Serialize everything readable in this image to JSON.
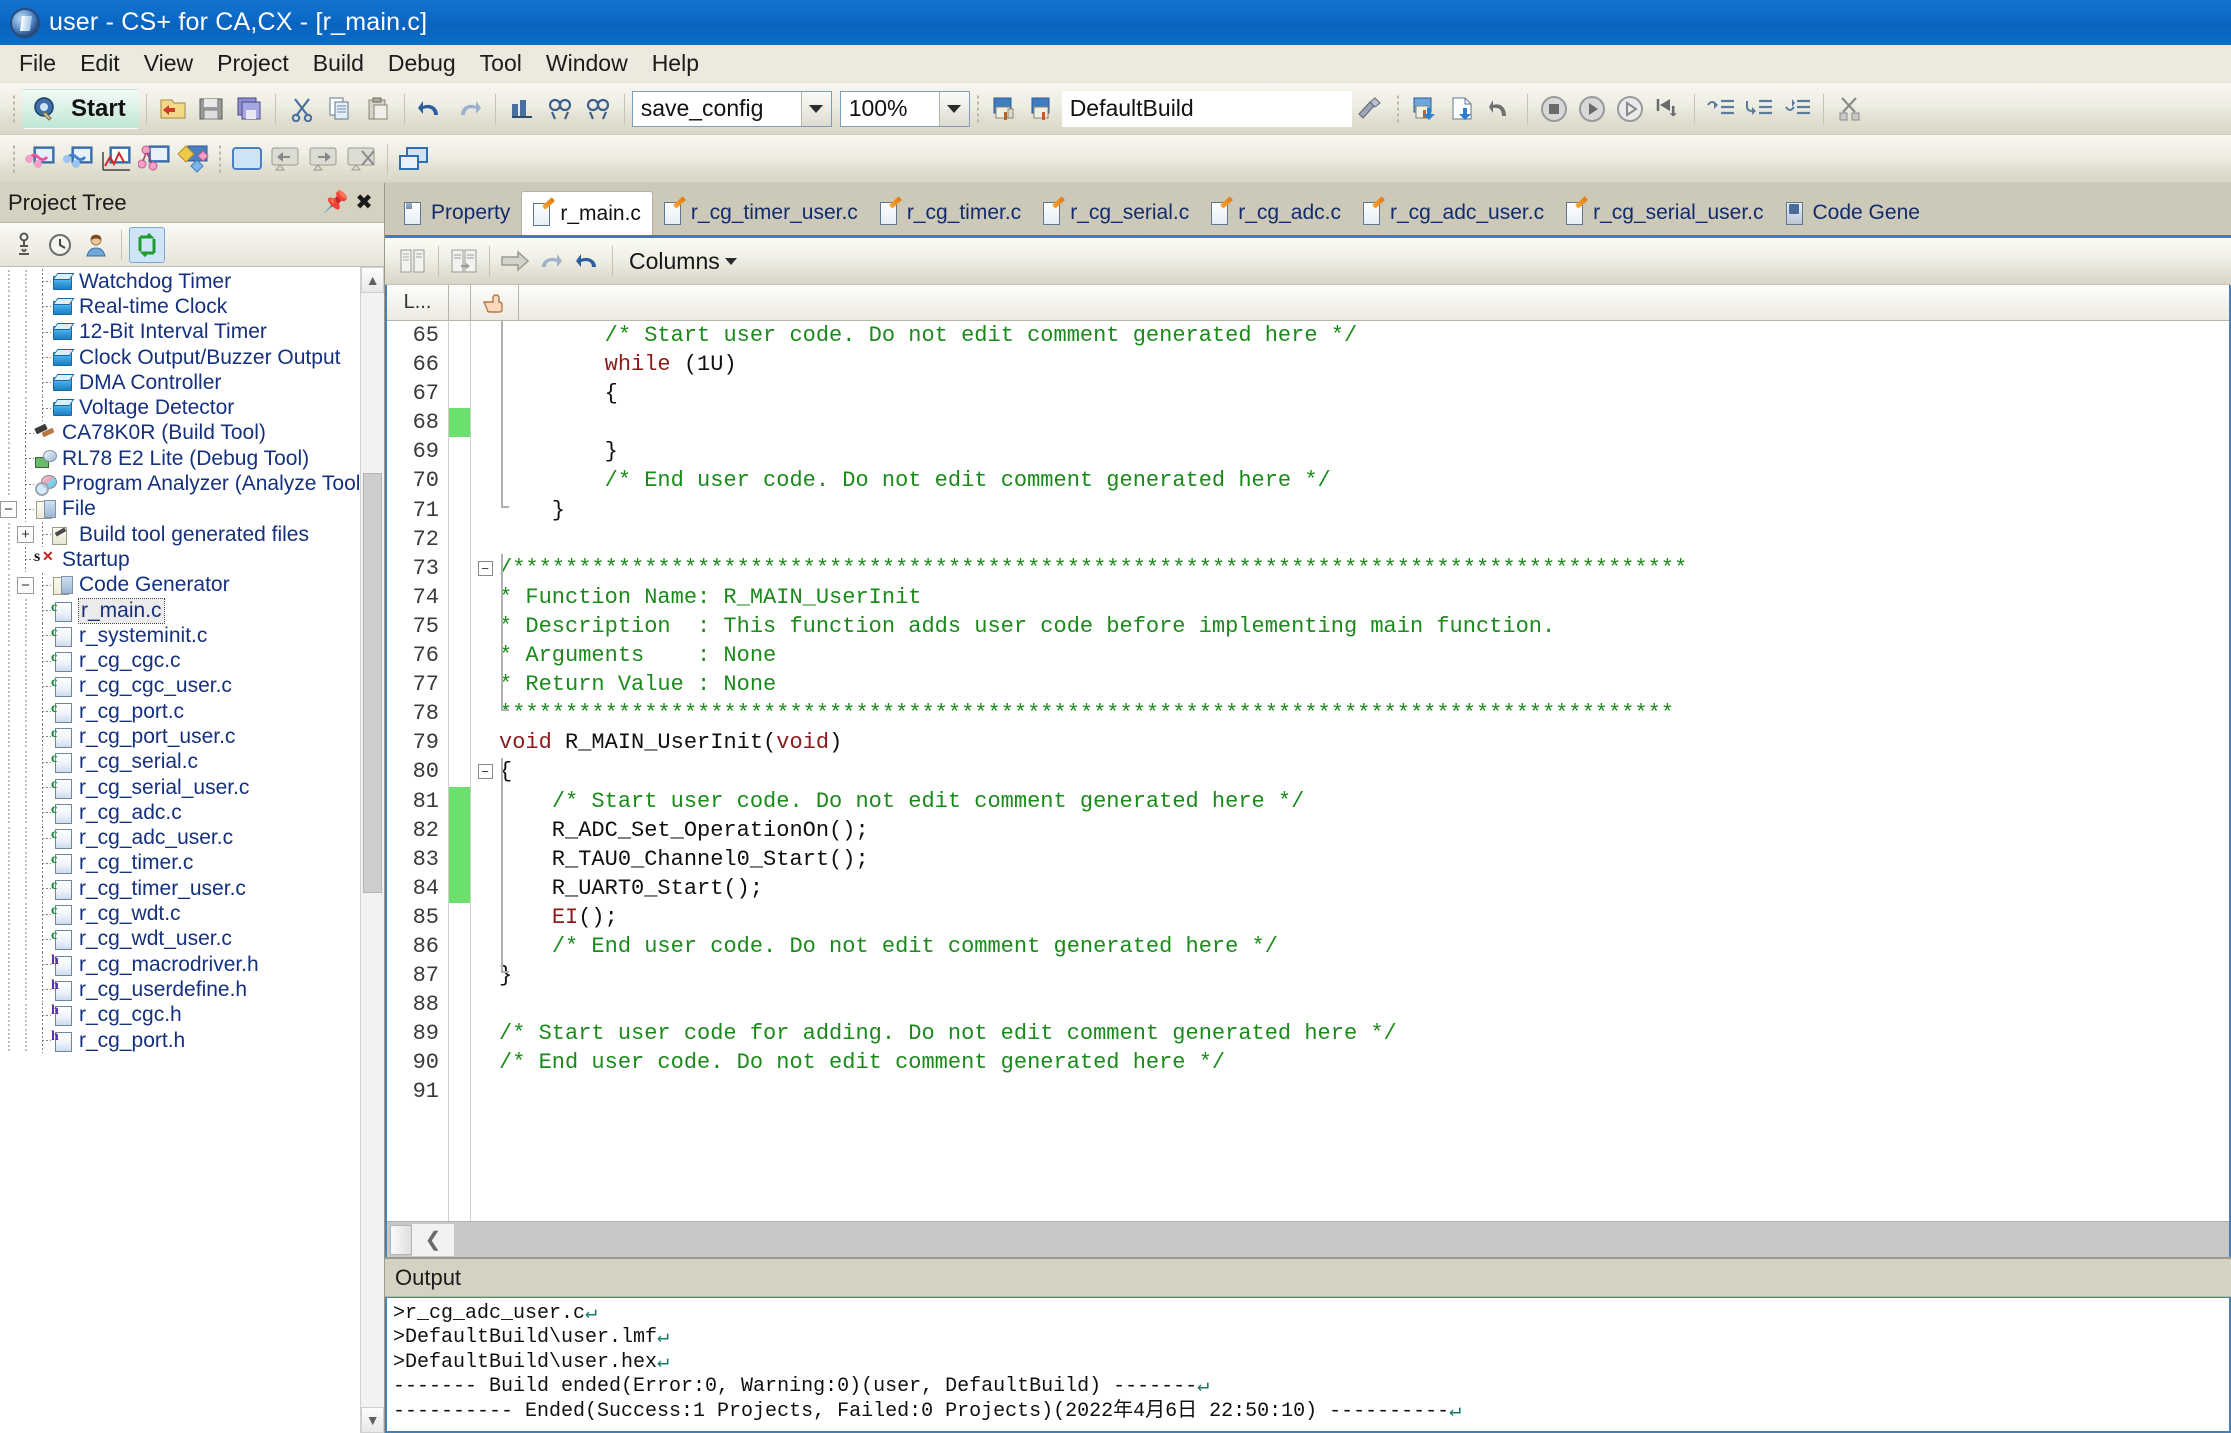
{
  "window": {
    "title": "user - CS+ for CA,CX - [r_main.c]",
    "app_icon": "cs-plus-icon"
  },
  "menubar": {
    "items": [
      "File",
      "Edit",
      "View",
      "Project",
      "Build",
      "Debug",
      "Tool",
      "Window",
      "Help"
    ]
  },
  "toolbar1": {
    "start_label": "Start",
    "start_icon": "start-debug-icon",
    "icons": [
      "open-project-icon",
      "save-icon",
      "save-all-icon",
      "cut-icon",
      "copy-icon",
      "paste-icon",
      "undo-icon",
      "redo-icon",
      "find-in-files-icon",
      "find-previous-icon",
      "find-next-icon"
    ],
    "config_combo": {
      "value": "save_config",
      "arrow": "chevron-down-icon"
    },
    "zoom_combo": {
      "value": "100%",
      "arrow": "chevron-down-icon"
    },
    "build_icons": [
      "build-project-icon",
      "rebuild-project-icon"
    ],
    "build_combo": {
      "value": "DefaultBuild"
    },
    "right_icons": [
      "build-tool-icon",
      "download-icon",
      "new-file-icon",
      "step-back-icon",
      "stop-icon",
      "go-icon",
      "run-icon",
      "restart-icon",
      "step-in-icon",
      "step-over-icon",
      "step-out-icon",
      "disconnect-icon"
    ]
  },
  "toolbar2": {
    "icons": [
      "analyze-pink-icon",
      "analyze-blue-icon",
      "chart-icon",
      "function-list-icon",
      "tag-icon",
      "window-icon",
      "back-window-icon",
      "forward-window-icon",
      "close-window-icon",
      "cascade-windows-icon"
    ]
  },
  "project_tree": {
    "panel_title": "Project Tree",
    "pin_icon": "pin-icon",
    "close_icon": "close-icon",
    "toolbar_icons": [
      "microscope-icon",
      "clock-icon",
      "user-icon",
      "refresh-icon"
    ],
    "items": [
      {
        "label": "Watchdog Timer",
        "icon": "cube-icon",
        "depth": 3,
        "expander": "",
        "selected": false
      },
      {
        "label": "Real-time Clock",
        "icon": "cube-icon",
        "depth": 3,
        "expander": "",
        "selected": false
      },
      {
        "label": "12-Bit Interval Timer",
        "icon": "cube-icon",
        "depth": 3,
        "expander": "",
        "selected": false
      },
      {
        "label": "Clock Output/Buzzer Output",
        "icon": "cube-icon",
        "depth": 3,
        "expander": "",
        "selected": false
      },
      {
        "label": "DMA Controller",
        "icon": "cube-icon",
        "depth": 3,
        "expander": "",
        "selected": false
      },
      {
        "label": "Voltage Detector",
        "icon": "cube-icon",
        "depth": 3,
        "expander": "",
        "selected": false
      },
      {
        "label": "CA78K0R (Build Tool)",
        "icon": "hammer-icon",
        "depth": 2,
        "expander": "",
        "selected": false
      },
      {
        "label": "RL78 E2 Lite (Debug Tool)",
        "icon": "debug-icon",
        "depth": 2,
        "expander": "",
        "selected": false
      },
      {
        "label": "Program Analyzer (Analyze Tool",
        "icon": "analyze-icon",
        "depth": 2,
        "expander": "",
        "selected": false
      },
      {
        "label": "File",
        "icon": "folder-icon",
        "depth": 1,
        "expander": "-",
        "selected": false
      },
      {
        "label": "Build tool generated files",
        "icon": "folder-build-icon",
        "depth": 2,
        "expander": "+",
        "selected": false
      },
      {
        "label": "Startup",
        "icon": "startup-icon",
        "depth": 2,
        "expander": "",
        "selected": false
      },
      {
        "label": "Code Generator",
        "icon": "folder-icon",
        "depth": 2,
        "expander": "-",
        "selected": false
      },
      {
        "label": "r_main.c",
        "icon": "c-file-icon",
        "depth": 3,
        "expander": "",
        "selected": true
      },
      {
        "label": "r_systeminit.c",
        "icon": "c-file-icon",
        "depth": 3,
        "expander": "",
        "selected": false
      },
      {
        "label": "r_cg_cgc.c",
        "icon": "c-file-icon",
        "depth": 3,
        "expander": "",
        "selected": false
      },
      {
        "label": "r_cg_cgc_user.c",
        "icon": "c-file-icon",
        "depth": 3,
        "expander": "",
        "selected": false
      },
      {
        "label": "r_cg_port.c",
        "icon": "c-file-icon",
        "depth": 3,
        "expander": "",
        "selected": false
      },
      {
        "label": "r_cg_port_user.c",
        "icon": "c-file-icon",
        "depth": 3,
        "expander": "",
        "selected": false
      },
      {
        "label": "r_cg_serial.c",
        "icon": "c-file-icon",
        "depth": 3,
        "expander": "",
        "selected": false
      },
      {
        "label": "r_cg_serial_user.c",
        "icon": "c-file-icon",
        "depth": 3,
        "expander": "",
        "selected": false
      },
      {
        "label": "r_cg_adc.c",
        "icon": "c-file-icon",
        "depth": 3,
        "expander": "",
        "selected": false
      },
      {
        "label": "r_cg_adc_user.c",
        "icon": "c-file-icon",
        "depth": 3,
        "expander": "",
        "selected": false
      },
      {
        "label": "r_cg_timer.c",
        "icon": "c-file-icon",
        "depth": 3,
        "expander": "",
        "selected": false
      },
      {
        "label": "r_cg_timer_user.c",
        "icon": "c-file-icon",
        "depth": 3,
        "expander": "",
        "selected": false
      },
      {
        "label": "r_cg_wdt.c",
        "icon": "c-file-icon",
        "depth": 3,
        "expander": "",
        "selected": false
      },
      {
        "label": "r_cg_wdt_user.c",
        "icon": "c-file-icon",
        "depth": 3,
        "expander": "",
        "selected": false
      },
      {
        "label": "r_cg_macrodriver.h",
        "icon": "h-file-icon",
        "depth": 3,
        "expander": "",
        "selected": false
      },
      {
        "label": "r_cg_userdefine.h",
        "icon": "h-file-icon",
        "depth": 3,
        "expander": "",
        "selected": false
      },
      {
        "label": "r_cg_cgc.h",
        "icon": "h-file-icon",
        "depth": 3,
        "expander": "",
        "selected": false
      },
      {
        "label": "r_cg_port.h",
        "icon": "h-file-icon",
        "depth": 3,
        "expander": "",
        "selected": false
      }
    ]
  },
  "editor": {
    "tabs": [
      {
        "label": "Property",
        "icon": "property-icon",
        "active": false
      },
      {
        "label": "r_main.c",
        "icon": "source-file-icon",
        "active": true
      },
      {
        "label": "r_cg_timer_user.c",
        "icon": "source-file-icon",
        "active": false
      },
      {
        "label": "r_cg_timer.c",
        "icon": "source-file-icon",
        "active": false
      },
      {
        "label": "r_cg_serial.c",
        "icon": "source-file-icon",
        "active": false
      },
      {
        "label": "r_cg_adc.c",
        "icon": "source-file-icon",
        "active": false
      },
      {
        "label": "r_cg_adc_user.c",
        "icon": "source-file-icon",
        "active": false
      },
      {
        "label": "r_cg_serial_user.c",
        "icon": "source-file-icon",
        "active": false
      },
      {
        "label": "Code Gene",
        "icon": "code-generator-icon",
        "active": false
      }
    ],
    "toolbar": {
      "icons": [
        "split-view-icon",
        "compare-icon",
        "go-to-icon",
        "redo-icon",
        "undo-icon"
      ],
      "columns_label": "Columns",
      "columns_arrow": "chevron-down-icon"
    },
    "column_headers": [
      "L...",
      "pointer-icon"
    ],
    "first_line_number": 65,
    "lines": [
      {
        "n": 65,
        "changed": false,
        "fold": "",
        "segs": [
          {
            "t": "        ",
            "c": "pl"
          },
          {
            "t": "/* Start user code. Do not edit comment generated here */",
            "c": "com"
          }
        ]
      },
      {
        "n": 66,
        "changed": false,
        "fold": "",
        "segs": [
          {
            "t": "        ",
            "c": "pl"
          },
          {
            "t": "while",
            "c": "kw"
          },
          {
            "t": " (1U)",
            "c": "pl"
          }
        ]
      },
      {
        "n": 67,
        "changed": false,
        "fold": "",
        "segs": [
          {
            "t": "        {",
            "c": "pl"
          }
        ]
      },
      {
        "n": 68,
        "changed": true,
        "fold": "",
        "segs": [
          {
            "t": "",
            "c": "pl"
          }
        ]
      },
      {
        "n": 69,
        "changed": false,
        "fold": "",
        "segs": [
          {
            "t": "        }",
            "c": "pl"
          }
        ]
      },
      {
        "n": 70,
        "changed": false,
        "fold": "",
        "segs": [
          {
            "t": "        ",
            "c": "pl"
          },
          {
            "t": "/* End user code. Do not edit comment generated here */",
            "c": "com"
          }
        ]
      },
      {
        "n": 71,
        "changed": false,
        "fold": "",
        "segs": [
          {
            "t": "    }",
            "c": "pl"
          }
        ]
      },
      {
        "n": 72,
        "changed": false,
        "fold": "",
        "segs": [
          {
            "t": "",
            "c": "pl"
          }
        ]
      },
      {
        "n": 73,
        "changed": false,
        "fold": "-",
        "segs": [
          {
            "t": "/*****************************************************************************************",
            "c": "com"
          }
        ]
      },
      {
        "n": 74,
        "changed": false,
        "fold": "",
        "segs": [
          {
            "t": "* Function Name: R_MAIN_UserInit",
            "c": "com"
          }
        ]
      },
      {
        "n": 75,
        "changed": false,
        "fold": "",
        "segs": [
          {
            "t": "* Description  : This function adds user code before implementing main function.",
            "c": "com"
          }
        ]
      },
      {
        "n": 76,
        "changed": false,
        "fold": "",
        "segs": [
          {
            "t": "* Arguments    : None",
            "c": "com"
          }
        ]
      },
      {
        "n": 77,
        "changed": false,
        "fold": "",
        "segs": [
          {
            "t": "* Return Value : None",
            "c": "com"
          }
        ]
      },
      {
        "n": 78,
        "changed": false,
        "fold": "",
        "segs": [
          {
            "t": "*****************************************************************************************",
            "c": "com"
          }
        ]
      },
      {
        "n": 79,
        "changed": false,
        "fold": "",
        "segs": [
          {
            "t": "void",
            "c": "kw"
          },
          {
            "t": " R_MAIN_UserInit(",
            "c": "pl"
          },
          {
            "t": "void",
            "c": "kw"
          },
          {
            "t": ")",
            "c": "pl"
          }
        ]
      },
      {
        "n": 80,
        "changed": false,
        "fold": "-",
        "segs": [
          {
            "t": "{",
            "c": "pl"
          }
        ]
      },
      {
        "n": 81,
        "changed": true,
        "fold": "",
        "segs": [
          {
            "t": "    ",
            "c": "pl"
          },
          {
            "t": "/* Start user code. Do not edit comment generated here */",
            "c": "com"
          }
        ]
      },
      {
        "n": 82,
        "changed": true,
        "fold": "",
        "segs": [
          {
            "t": "    R_ADC_Set_OperationOn();",
            "c": "pl"
          }
        ]
      },
      {
        "n": 83,
        "changed": true,
        "fold": "",
        "segs": [
          {
            "t": "    R_TAU0_Channel0_Start();",
            "c": "pl"
          }
        ]
      },
      {
        "n": 84,
        "changed": true,
        "fold": "",
        "segs": [
          {
            "t": "    R_UART0_Start();",
            "c": "pl"
          }
        ]
      },
      {
        "n": 85,
        "changed": false,
        "fold": "",
        "segs": [
          {
            "t": "    ",
            "c": "pl"
          },
          {
            "t": "EI",
            "c": "kw"
          },
          {
            "t": "();",
            "c": "pl"
          }
        ]
      },
      {
        "n": 86,
        "changed": false,
        "fold": "",
        "segs": [
          {
            "t": "    ",
            "c": "pl"
          },
          {
            "t": "/* End user code. Do not edit comment generated here */",
            "c": "com"
          }
        ]
      },
      {
        "n": 87,
        "changed": false,
        "fold": "",
        "segs": [
          {
            "t": "}",
            "c": "pl"
          }
        ]
      },
      {
        "n": 88,
        "changed": false,
        "fold": "",
        "segs": [
          {
            "t": "",
            "c": "pl"
          }
        ]
      },
      {
        "n": 89,
        "changed": false,
        "fold": "",
        "segs": [
          {
            "t": "/* Start user code for adding. Do not edit comment generated here */",
            "c": "com"
          }
        ]
      },
      {
        "n": 90,
        "changed": false,
        "fold": "",
        "segs": [
          {
            "t": "/* End user code. Do not edit comment generated here */",
            "c": "com"
          }
        ]
      },
      {
        "n": 91,
        "changed": false,
        "fold": "",
        "segs": [
          {
            "t": "",
            "c": "pl"
          }
        ]
      }
    ],
    "hscroll_left_icon": "chevron-left-icon"
  },
  "output": {
    "title": "Output",
    "lines": [
      ">r_cg_adc_user.c",
      ">DefaultBuild\\user.lmf",
      ">DefaultBuild\\user.hex",
      "------- Build ended(Error:0, Warning:0)(user, DefaultBuild) -------",
      "---------- Ended(Success:1 Projects, Failed:0 Projects)(2022年4月6日 22:50:10) ----------"
    ],
    "crlf_marker": "↵"
  },
  "colors": {
    "titlebar": "#0a68c4",
    "menubar": "#eceade",
    "panel_header": "#d6d2c2",
    "comment_green": "#1a8a1a",
    "keyword_red": "#8b1a1a",
    "tree_text_blue": "#15317e",
    "changed_marker_green": "#6ce06c",
    "editor_border_blue": "#4a7fb5"
  }
}
